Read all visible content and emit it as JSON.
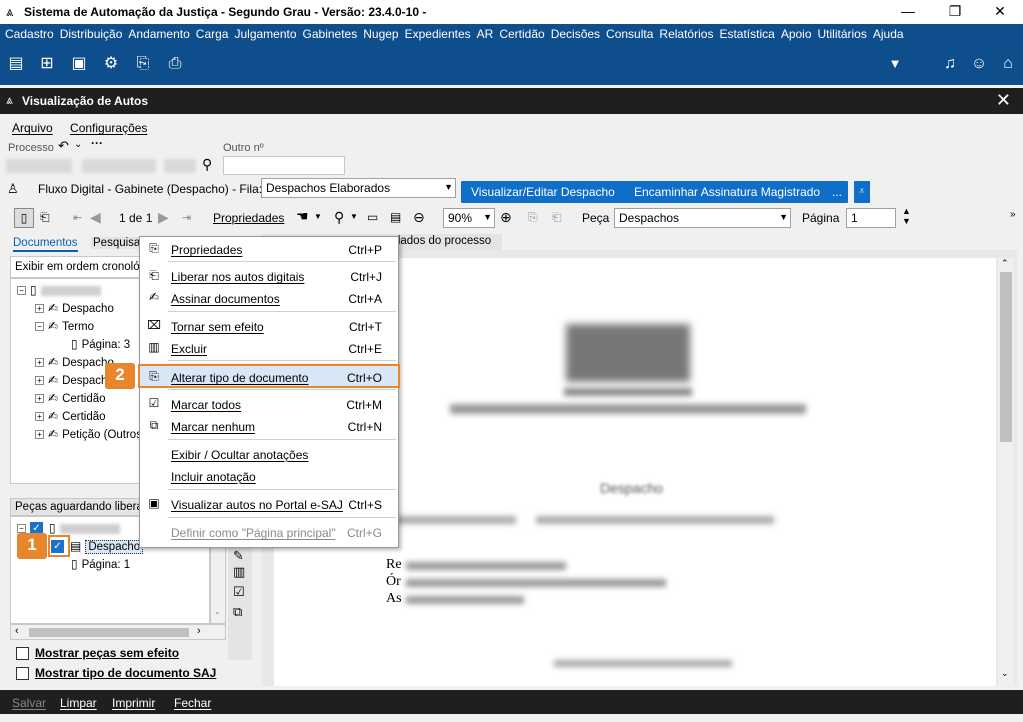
{
  "window": {
    "title": "Sistema de Automação da Justiça - Segundo Grau - Versão: 23.4.0-10 -",
    "minimize": "—",
    "restore": "❐",
    "close": "✕"
  },
  "menu": [
    "Cadastro",
    "Distribuição",
    "Andamento",
    "Carga",
    "Julgamento",
    "Gabinetes",
    "Nugep",
    "Expedientes",
    "AR",
    "Certidão",
    "Decisões",
    "Consulta",
    "Relatórios",
    "Estatística",
    "Apoio",
    "Utilitários",
    "Ajuda"
  ],
  "subwindow": {
    "title": "Visualização de Autos",
    "menu": [
      "Arquivo",
      "Configurações"
    ]
  },
  "form": {
    "processo_label": "Processo",
    "outro_label": "Outro nº",
    "fluxo_label": "Fluxo Digital - Gabinete (Despacho) - Fila:",
    "fila_value": "Despachos Elaborados",
    "btn_visualizar": "Visualizar/Editar Despacho",
    "btn_encaminhar": "Encaminhar Assinatura Magistrado",
    "btn_more": "..."
  },
  "toolbar": {
    "page_of": "1 de 1",
    "propriedades": "Propriedades",
    "zoom": "90%",
    "peca_label": "Peça",
    "peca_value": "Despachos",
    "pagina_label": "Página",
    "pagina_value": "1"
  },
  "left_tabs": [
    "Documentos",
    "Pesquisar"
  ],
  "right_tabs": [
    "dados do processo"
  ],
  "order_select": "Exibir em ordem cronológica",
  "tree": [
    {
      "label": "Despacho"
    },
    {
      "label": "Termo"
    },
    {
      "label": "Página: 3"
    },
    {
      "label": "Despacho"
    },
    {
      "label": "Despacho"
    },
    {
      "label": "Certidão"
    },
    {
      "label": "Certidão"
    },
    {
      "label": "Petição (Outros)"
    }
  ],
  "pending": {
    "title": "Peças aguardando liberação",
    "item": "Despacho",
    "page": "Página: 1"
  },
  "checkboxes": {
    "sem_efeito": "Mostrar peças sem efeito",
    "tipo_doc": "Mostrar tipo de documento SAJ"
  },
  "context_menu": [
    {
      "label": "Propriedades",
      "shortcut": "Ctrl+P",
      "icon": "properties-icon"
    },
    {
      "label": "Liberar nos autos digitais",
      "shortcut": "Ctrl+J",
      "icon": "release-icon"
    },
    {
      "label": "Assinar documentos",
      "shortcut": "Ctrl+A",
      "icon": "sign-icon"
    },
    {
      "label": "Tornar sem efeito",
      "shortcut": "Ctrl+T",
      "icon": "void-icon"
    },
    {
      "label": "Excluir",
      "shortcut": "Ctrl+E",
      "icon": "trash-icon"
    },
    {
      "label": "Alterar tipo de documento",
      "shortcut": "Ctrl+O",
      "icon": "change-type-icon"
    },
    {
      "label": "Marcar todos",
      "shortcut": "Ctrl+M",
      "icon": "check-all-icon"
    },
    {
      "label": "Marcar nenhum",
      "shortcut": "Ctrl+N",
      "icon": "uncheck-all-icon"
    },
    {
      "label": "Exibir / Ocultar anotações",
      "shortcut": "",
      "icon": ""
    },
    {
      "label": "Incluir anotação",
      "shortcut": "",
      "icon": ""
    },
    {
      "label": "Visualizar autos no Portal e-SAJ",
      "shortcut": "Ctrl+S",
      "icon": "portal-icon"
    },
    {
      "label": "Definir como \"Página principal\"",
      "shortcut": "Ctrl+G",
      "icon": ""
    }
  ],
  "steps": {
    "one": "1",
    "two": "2"
  },
  "doc_lines": {
    "heading": "Despacho",
    "r1": "Re",
    "r2": "Ór",
    "r3": "As"
  },
  "statusbar": [
    "Salvar",
    "Limpar",
    "Imprimir",
    "Fechar"
  ]
}
